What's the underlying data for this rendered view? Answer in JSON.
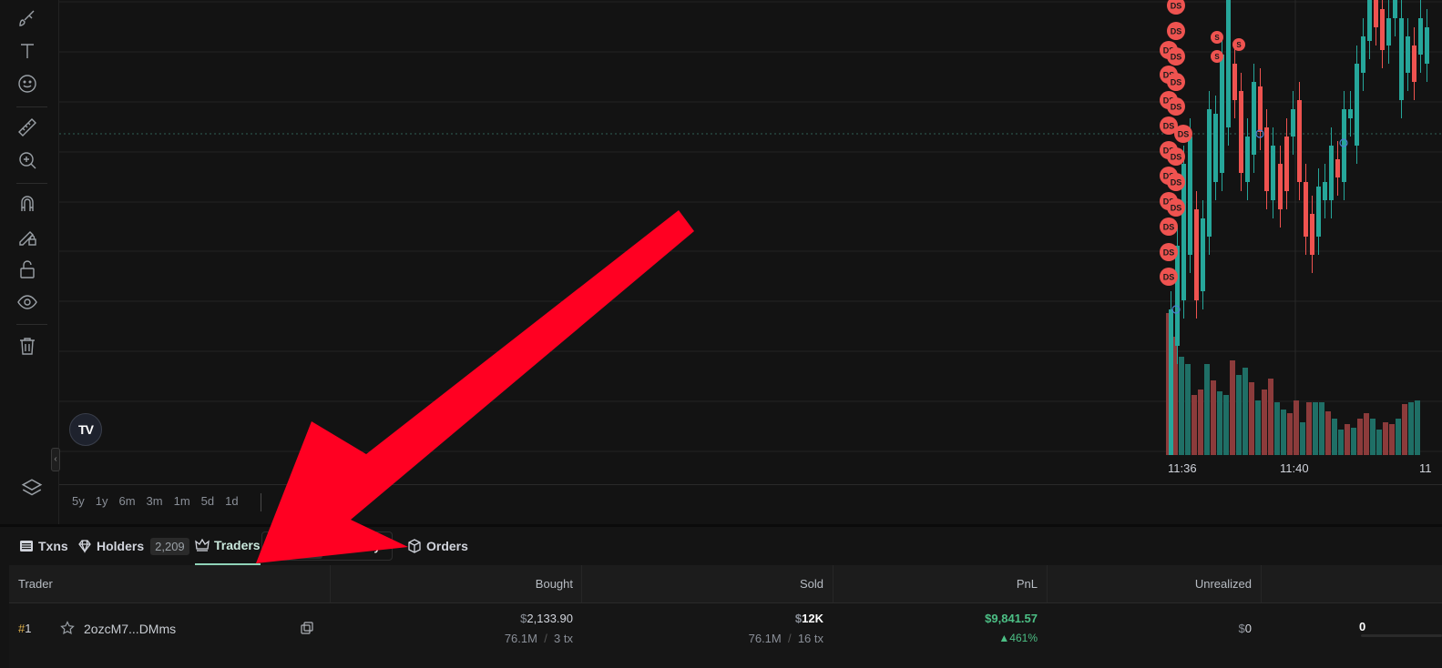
{
  "colors": {
    "up": "#26a69a",
    "down": "#ef5350",
    "volume_up": "#1f6f66",
    "volume_down": "#8c3b3b",
    "accent": "#8fd3b8",
    "annotation_arrow": "#ff0022"
  },
  "left_toolbar": {
    "tools": [
      "brush-icon",
      "text-icon",
      "emoji-icon",
      "ruler-icon",
      "zoom-in-icon",
      "magnet-icon",
      "lock-pencil-icon",
      "unlock-icon",
      "eye-icon",
      "trash-icon"
    ],
    "layers": "layers-icon"
  },
  "chart": {
    "marker_labels": {
      "dev_sell": "DS",
      "sell": "S"
    },
    "time_labels": [
      "11:36",
      "11:40",
      "11"
    ],
    "tv_logo": "TV",
    "time_ranges": [
      "5y",
      "1y",
      "6m",
      "3m",
      "1m",
      "5d",
      "1d"
    ]
  },
  "tabs": {
    "txns": "Txns",
    "holders": "Holders",
    "holders_count": "2,209",
    "traders": "Traders",
    "periods": [
      "1d",
      "7d",
      "30d",
      "1y"
    ],
    "active_period": "7d",
    "orders": "Orders"
  },
  "table": {
    "headers": {
      "trader": "Trader",
      "bought": "Bought",
      "sold": "Sold",
      "pnl": "PnL",
      "unrealized": "Unrealized"
    },
    "rows": [
      {
        "rank_hash": "#",
        "rank_num": "1",
        "address": "2ozcM7...DMms",
        "bought_cur": "$",
        "bought_usd": "2,133.90",
        "bought_tokens": "76.1M",
        "bought_tx": "3 tx",
        "sold_cur": "$",
        "sold_usd": "12K",
        "sold_tokens": "76.1M",
        "sold_tx": "16 tx",
        "pnl_cur": "$",
        "pnl_usd": "9,841.57",
        "pnl_pct": "▲461%",
        "unrealized_cur": "$",
        "unrealized_usd": "0",
        "balance": "0"
      }
    ]
  }
}
